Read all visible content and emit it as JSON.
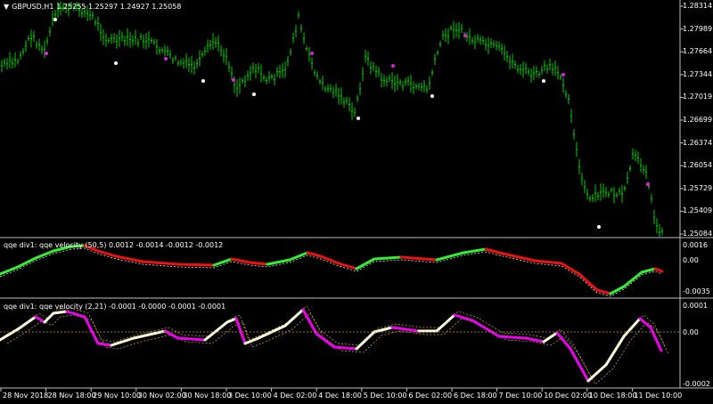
{
  "main": {
    "symbol": "GBPUSD,H1",
    "ohlc": "1.25255 1.25297 1.24927 1.25058",
    "price_labels": [
      "1.28314",
      "1.27989",
      "1.27664",
      "1.27344",
      "1.27019",
      "1.26699",
      "1.26374",
      "1.26054",
      "1.25729",
      "1.25409",
      "1.25084"
    ],
    "current_price": "1.25084"
  },
  "indicator1": {
    "title": "qqe div1: qqe velocity (50,5) 0.0012 -0.0014 -0.0012 -0.0012",
    "scale_labels": [
      "0.0016",
      "0.00",
      "-0.0035"
    ]
  },
  "indicator2": {
    "title": "qqe div1: qqe velocity (2,21) -0.0001 -0.0000 -0.0001 -0.0001",
    "scale_labels": [
      "0.0001",
      "0.00",
      "-0.0002"
    ]
  },
  "time_axis": [
    "28 Nov 2018",
    "28 Nov 18:00",
    "29 Nov 10:00",
    "30 Nov 02:00",
    "30 Nov 18:00",
    "3 Dec 10:00",
    "4 Dec 02:00",
    "4 Dec 18:00",
    "5 Dec 10:00",
    "6 Dec 02:00",
    "6 Dec 18:00",
    "7 Dec 10:00",
    "10 Dec 02:00",
    "10 Dec 18:00",
    "11 Dec 10:00"
  ],
  "colors": {
    "bars": "#00cc00",
    "up_line": "#33ee33",
    "down_line": "#ee1111",
    "osc2_up": "#ffffe0",
    "osc2_down": "#ee00ee",
    "dots_white": "#ffffff",
    "dots_magenta": "#dd22dd",
    "grid": "#c0c0c0",
    "signal": "#d8b040"
  }
}
